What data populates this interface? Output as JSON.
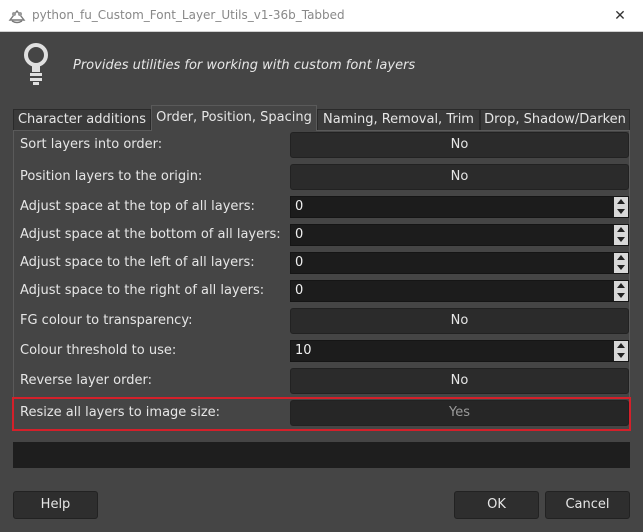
{
  "window": {
    "title": "python_fu_Custom_Font_Layer_Utils_v1-36b_Tabbed",
    "close_glyph": "✕"
  },
  "header": {
    "icon": "lightbulb-icon",
    "description": "Provides utilities for working with custom font layers"
  },
  "tabs": [
    {
      "label": "Character additions",
      "active": false
    },
    {
      "label": "Order, Position, Spacing",
      "active": true
    },
    {
      "label": "Naming, Removal, Trim",
      "active": false
    },
    {
      "label": "Drop, Shadow/Darken",
      "active": false
    }
  ],
  "fields": [
    {
      "label": "Sort layers into order:",
      "kind": "toggle",
      "value": "No"
    },
    {
      "label": "Position layers to the origin:",
      "kind": "toggle",
      "value": "No"
    },
    {
      "label": "Adjust space at the top of all layers:",
      "kind": "spin",
      "value": "0"
    },
    {
      "label": "Adjust space at the bottom of all layers:",
      "kind": "spin",
      "value": "0"
    },
    {
      "label": "Adjust space to the left of all layers:",
      "kind": "spin",
      "value": "0"
    },
    {
      "label": "Adjust space to the right of all layers:",
      "kind": "spin",
      "value": "0"
    },
    {
      "label": "FG colour to transparency:",
      "kind": "toggle",
      "value": "No"
    },
    {
      "label": "Colour threshold to use:",
      "kind": "spin",
      "value": "10"
    },
    {
      "label": "Reverse layer order:",
      "kind": "toggle",
      "value": "No"
    },
    {
      "label": "Resize all layers to image size:",
      "kind": "toggle",
      "value": "Yes"
    }
  ],
  "buttons": {
    "help": "Help",
    "ok": "OK",
    "cancel": "Cancel"
  },
  "colors": {
    "highlight": "#d4202a",
    "background": "#454545"
  }
}
